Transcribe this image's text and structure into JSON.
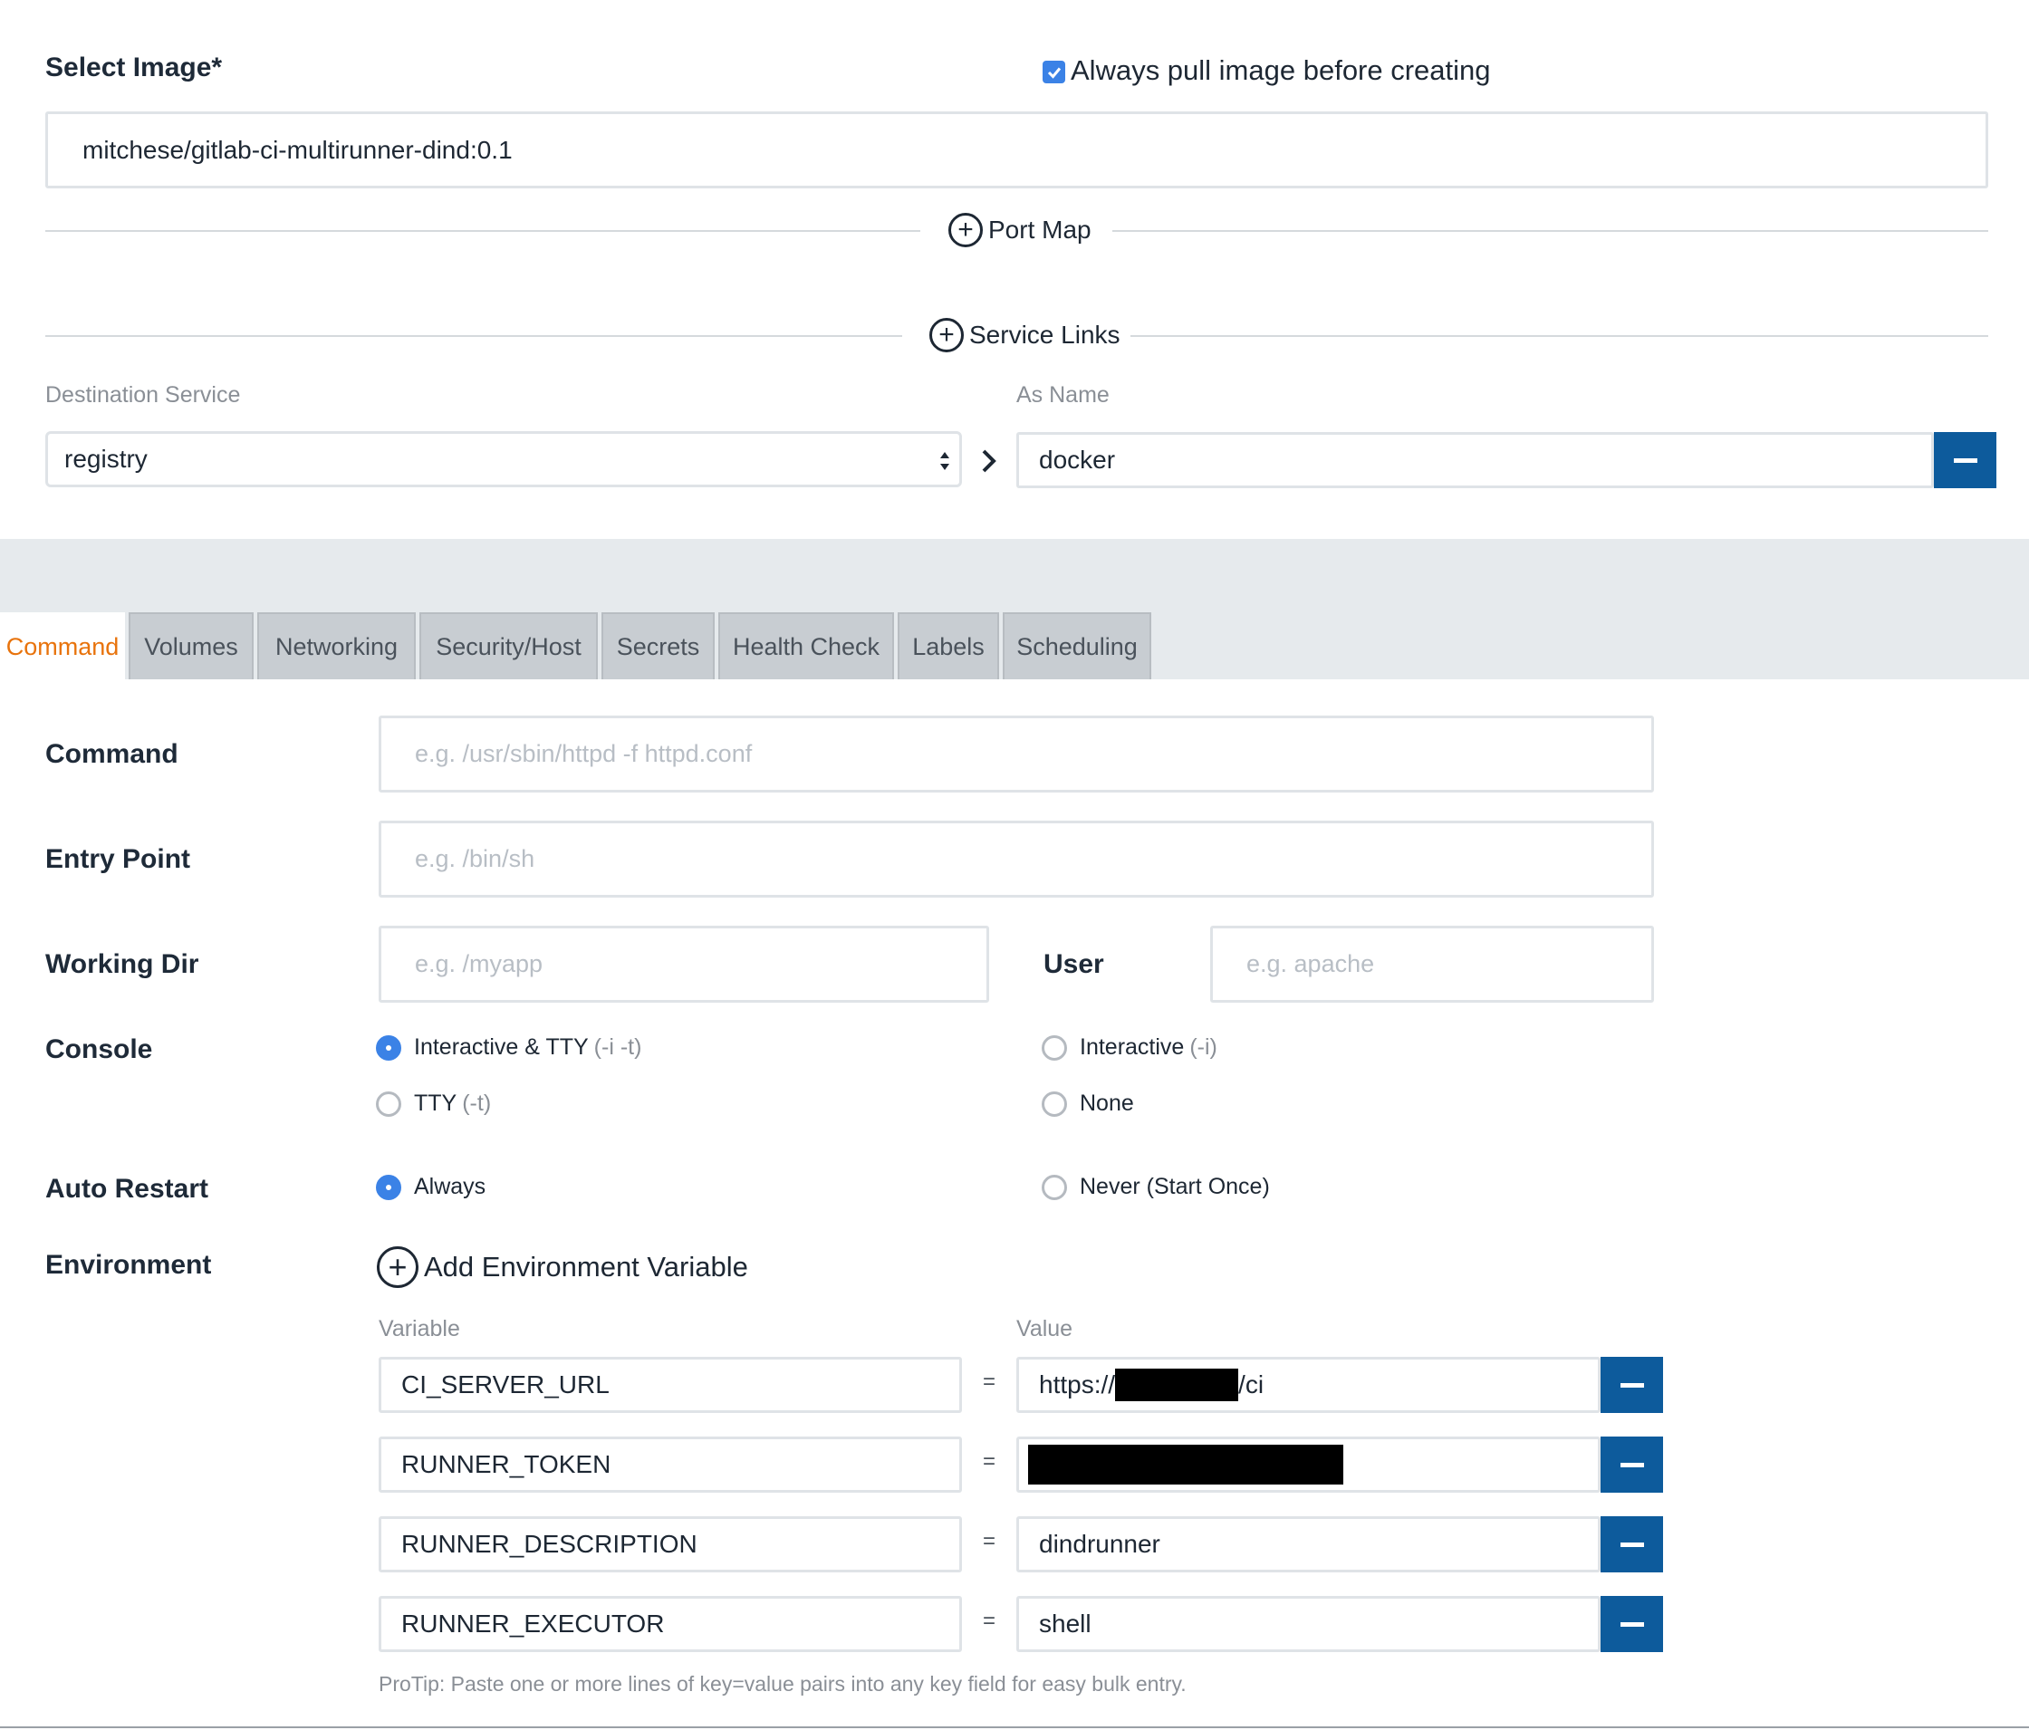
{
  "image": {
    "label": "Select Image*",
    "always_pull_label": "Always pull image before creating",
    "always_pull_checked": true,
    "value": "mitchese/gitlab-ci-multirunner-dind:0.1"
  },
  "port_map": {
    "label": "Port Map"
  },
  "service_links": {
    "label": "Service Links",
    "destination_label": "Destination Service",
    "as_name_label": "As Name",
    "destination_value": "registry",
    "as_name_value": "docker"
  },
  "tabs": [
    {
      "label": "Command",
      "active": true
    },
    {
      "label": "Volumes"
    },
    {
      "label": "Networking"
    },
    {
      "label": "Security/Host"
    },
    {
      "label": "Secrets"
    },
    {
      "label": "Health Check"
    },
    {
      "label": "Labels"
    },
    {
      "label": "Scheduling"
    }
  ],
  "form": {
    "command": {
      "label": "Command",
      "placeholder": "e.g. /usr/sbin/httpd -f httpd.conf"
    },
    "entry_point": {
      "label": "Entry Point",
      "placeholder": "e.g. /bin/sh"
    },
    "working_dir": {
      "label": "Working Dir",
      "placeholder": "e.g. /myapp"
    },
    "user": {
      "label": "User",
      "placeholder": "e.g. apache"
    },
    "console": {
      "label": "Console",
      "options": [
        {
          "label": "Interactive & TTY",
          "hint": "(-i -t)",
          "selected": true
        },
        {
          "label": "Interactive",
          "hint": "(-i)",
          "selected": false
        },
        {
          "label": "TTY",
          "hint": "(-t)",
          "selected": false
        },
        {
          "label": "None",
          "hint": "",
          "selected": false
        }
      ]
    },
    "auto_restart": {
      "label": "Auto Restart",
      "options": [
        {
          "label": "Always",
          "selected": true
        },
        {
          "label": "Never (Start Once)",
          "selected": false
        }
      ]
    },
    "environment": {
      "label": "Environment",
      "add_label": "Add Environment Variable",
      "variable_header": "Variable",
      "value_header": "Value",
      "equals": "=",
      "rows": [
        {
          "key": "CI_SERVER_URL",
          "value_prefix": "https://",
          "value_suffix": "/ci",
          "redacted": true
        },
        {
          "key": "RUNNER_TOKEN",
          "value_prefix": "",
          "value_suffix": "",
          "redacted": true
        },
        {
          "key": "RUNNER_DESCRIPTION",
          "value_prefix": "dindrunner",
          "value_suffix": "",
          "redacted": false
        },
        {
          "key": "RUNNER_EXECUTOR",
          "value_prefix": "shell",
          "value_suffix": "",
          "redacted": false
        }
      ],
      "protip": "ProTip: Paste one or more lines of key=value pairs into any key field for easy bulk entry."
    }
  },
  "colors": {
    "accent": "#0d5b9c",
    "active_tab_text": "#e8730c",
    "radio_selected": "#3b82e6",
    "tab_bar_bg": "#e6eaed"
  }
}
